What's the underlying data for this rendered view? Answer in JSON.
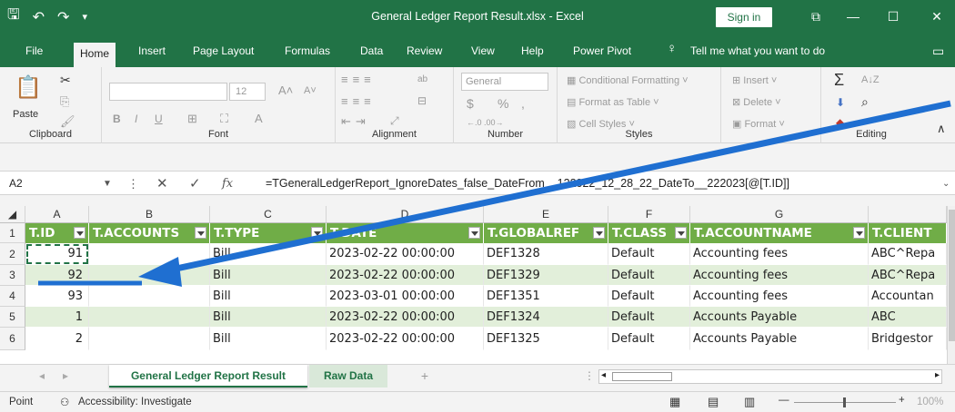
{
  "titlebar": {
    "title": "General Ledger Report Result.xlsx  -  Excel",
    "sign_in": "Sign in",
    "minimize": "—",
    "restore": "☐",
    "close": "✕"
  },
  "menu": {
    "items": [
      "File",
      "Home",
      "Insert",
      "Page Layout",
      "Formulas",
      "Data",
      "Review",
      "View",
      "Help",
      "Power Pivot"
    ],
    "tell_me": "Tell me what you want to do"
  },
  "ribbon": {
    "clipboard": {
      "label": "Clipboard",
      "paste": "Paste"
    },
    "font": {
      "label": "Font",
      "size": "12",
      "bold": "B",
      "italic": "I",
      "underline": "U"
    },
    "alignment": {
      "label": "Alignment"
    },
    "number": {
      "label": "Number",
      "format": "General",
      "currency": "$",
      "percent": "%",
      "comma": ","
    },
    "styles": {
      "label": "Styles",
      "conditional": "Conditional Formatting",
      "format_table": "Format as Table",
      "cell_styles": "Cell Styles"
    },
    "cells": {
      "insert": "Insert",
      "delete": "Delete",
      "format": "Format"
    },
    "editing": {
      "label": "Editing"
    }
  },
  "formula_bar": {
    "name_box": "A2",
    "fx": "fx",
    "formula": "=TGeneralLedgerReport_IgnoreDates_false_DateFrom__122022_12_28_22_DateTo__222023[@[T.ID]]"
  },
  "grid": {
    "columns": [
      "A",
      "B",
      "C",
      "D",
      "E",
      "F",
      "G"
    ],
    "rows": [
      "1",
      "2",
      "3",
      "4",
      "5",
      "6"
    ],
    "headers": [
      "T.ID",
      "T.ACCOUNTS",
      "T.TYPE",
      "T.DATE",
      "T.GLOBALREF",
      "T.CLASS",
      "T.ACCOUNTNAME",
      "T.CLIENT"
    ],
    "data": [
      [
        "91",
        "",
        "Bill",
        "2023-02-22 00:00:00",
        "DEF1328",
        "Default",
        "Accounting fees",
        "ABC^Repa"
      ],
      [
        "92",
        "",
        "Bill",
        "2023-02-22 00:00:00",
        "DEF1329",
        "Default",
        "Accounting fees",
        "ABC^Repa"
      ],
      [
        "93",
        "",
        "Bill",
        "2023-03-01 00:00:00",
        "DEF1351",
        "Default",
        "Accounting fees",
        "Accountan"
      ],
      [
        "1",
        "",
        "Bill",
        "2023-02-22 00:00:00",
        "DEF1324",
        "Default",
        "Accounts Payable",
        "ABC"
      ],
      [
        "2",
        "",
        "Bill",
        "2023-02-22 00:00:00",
        "DEF1325",
        "Default",
        "Accounts Payable",
        "Bridgestor"
      ]
    ]
  },
  "sheets": {
    "tabs": [
      "General Ledger Report Result",
      "Raw Data"
    ],
    "add": "+"
  },
  "status": {
    "mode": "Point",
    "accessibility": "Accessibility: Investigate",
    "zoom": "100%"
  },
  "colors": {
    "excel_green": "#217346",
    "table_header": "#70ad47",
    "band": "#e2efda",
    "arrow": "#1f6fd1"
  }
}
